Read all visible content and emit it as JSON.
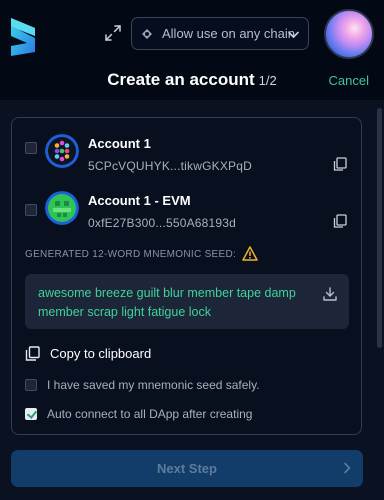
{
  "header": {
    "chain_selector": "Allow use on any chain",
    "title": "Create an account",
    "step": "1/2",
    "cancel": "Cancel"
  },
  "accounts": [
    {
      "name": "Account 1",
      "address": "5CPcVQUHYK...tikwGKXPqD",
      "avatar": "polkadot-identicon"
    },
    {
      "name": "Account 1 - EVM",
      "address": "0xfE27B300...550A68193d",
      "avatar": "evm-identicon"
    }
  ],
  "seed": {
    "label": "GENERATED 12-WORD MNEMONIC SEED:",
    "phrase": "awesome breeze guilt blur member tape damp member scrap light fatigue lock"
  },
  "copy_to_clipboard": "Copy to clipboard",
  "options": {
    "saved_seed": {
      "label": "I have saved my mnemonic seed safely.",
      "checked": false
    },
    "auto_connect": {
      "label": "Auto connect to all DApp after creating",
      "checked": true
    }
  },
  "next_button": "Next Step",
  "colors": {
    "accent_green": "#3fd29b",
    "button_bg": "#123d6b",
    "background": "#0a1121"
  }
}
